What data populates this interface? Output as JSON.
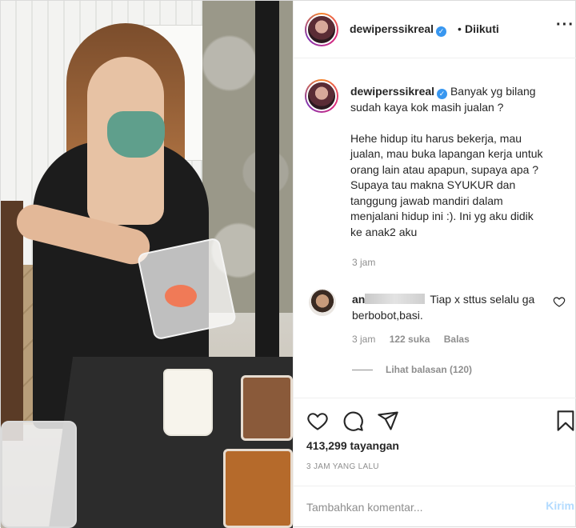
{
  "post": {
    "username": "dewiperssikreal",
    "verified_icon": "verified-badge-icon",
    "follow_separator": "•",
    "follow_status": "Diikuti",
    "more_icon": "more-options-icon"
  },
  "caption": {
    "username": "dewiperssikreal",
    "lines": [
      "Banyak yg bilang",
      "sudah kaya kok masih jualan ?",
      "",
      "Hehe hidup itu harus bekerja, mau",
      "jualan, mau buka lapangan kerja untuk",
      "orang lain atau apapun, supaya apa ?",
      "Supaya tau makna SYUKUR dan",
      "tanggung jawab mandiri dalam",
      "menjalani hidup ini :). Ini yg aku didik",
      "ke anak2 aku"
    ],
    "time": "3 jam"
  },
  "comment": {
    "username_visible": "an",
    "text_line1": "Tiap x sttus selalu ga",
    "text_line2": "berbobot,basi.",
    "time": "3 jam",
    "likes": "122 suka",
    "reply": "Balas",
    "view_replies": "Lihat balasan (120)",
    "like_icon": "heart-outline-icon"
  },
  "actions": {
    "icons": [
      "heart-icon",
      "comment-icon",
      "share-icon",
      "bookmark-icon"
    ],
    "views": "413,299 tayangan",
    "posted": "3 JAM YANG LALU"
  },
  "comment_box": {
    "placeholder": "Tambahkan komentar...",
    "post_label": "Kirim"
  },
  "colors": {
    "verified": "#3897f0",
    "muted": "#8e8e8e",
    "post_disabled": "#b3dbff",
    "text": "#262626"
  }
}
